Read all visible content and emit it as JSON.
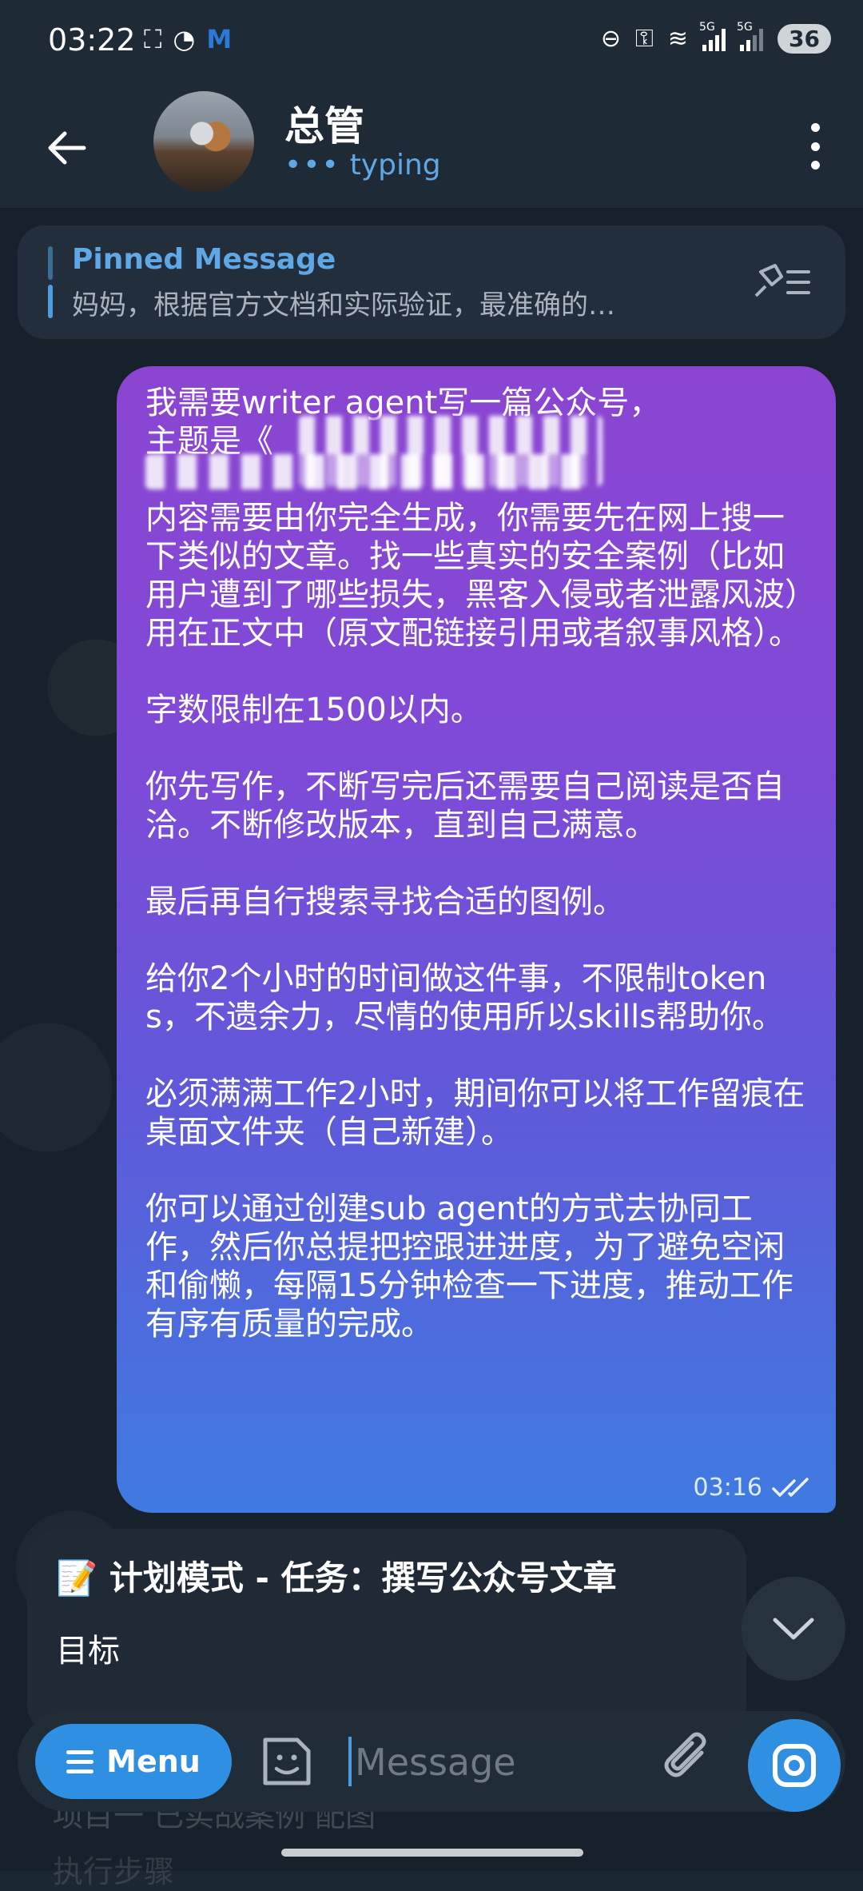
{
  "status_bar": {
    "time": "03:22",
    "battery": "36",
    "network_label_1": "5G",
    "network_label_2": "5G"
  },
  "header": {
    "title": "总管",
    "status": "typing",
    "status_color": "#5fa8e5"
  },
  "pinned": {
    "title": "Pinned Message",
    "text": "妈妈，根据官方文档和实际验证，最准确的…"
  },
  "outgoing_message": {
    "text": "我需要writer agent写一篇公众号，\n主题是《\n\n内容需要由你完全生成，你需要先在网上搜一下类似的文章。找一些真实的安全案例（比如用户遭到了哪些损失，黑客入侵或者泄露风波）用在正文中（原文配链接引用或者叙事风格）。\n\n字数限制在1500以内。\n\n你先写作，不断写完后还需要自己阅读是否自洽。不断修改版本，直到自己满意。\n\n最后再自行搜索寻找合适的图例。\n\n给你2个小时的时间做这件事，不限制tokens，不遗余力，尽情的使用所以skills帮助你。\n\n必须满满工作2小时，期间你可以将工作留痕在桌面文件夹（自己新建）。\n\n你可以通过创建sub agent的方式去协同工作，然后你总提把控跟进进度，为了避免空闲和偷懒，每隔15分钟检查一下进度，推动工作有序有质量的完成。",
    "time": "03:16"
  },
  "incoming_message": {
    "emoji": "📝",
    "title": "计划模式 - 任务：撰写公众号文章",
    "line1": "目标",
    "peek1": "项目一 已实战案例 配图",
    "peek2": "执行步骤"
  },
  "input": {
    "menu_label": "Menu",
    "placeholder": "Message"
  },
  "colors": {
    "accent": "#2f8fe3",
    "bubble_top": "#8b45d1",
    "bubble_bottom": "#3f7be0",
    "background": "#17212b"
  }
}
